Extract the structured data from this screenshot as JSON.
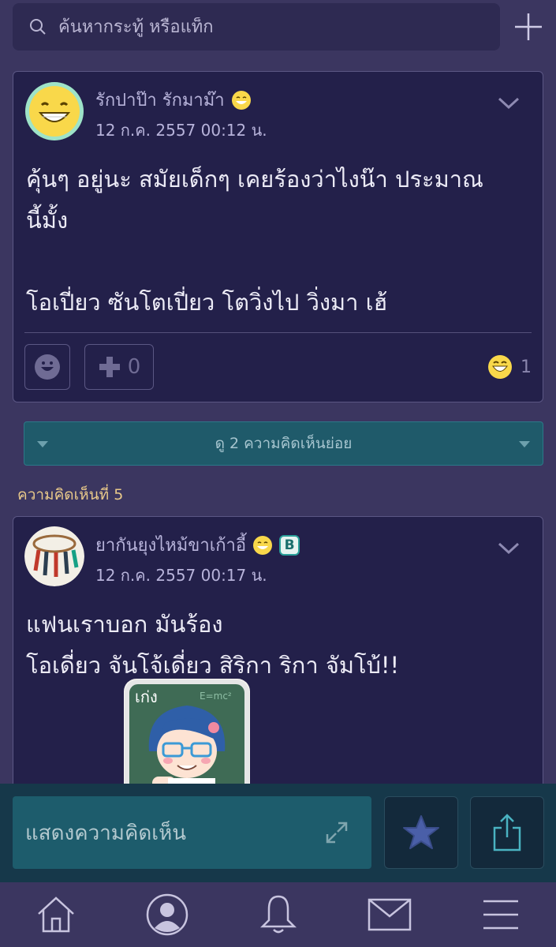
{
  "search": {
    "placeholder": "ค้นหากระทู้ หรือแท็ก"
  },
  "comment1": {
    "author": "รักปาป๊า รักมาม๊า",
    "date": "12 ก.ค. 2557 00:12 น.",
    "line1": "คุ้นๆ อยู่นะ สมัยเด็กๆ เคยร้องว่าไงน๊า ประมาณ",
    "line2": "นี้มั้ง",
    "line3": "โอเปี่ยว ซันโตเปี่ยว โตวิ่งไป วิ่งมา เฮ้",
    "vote_count": "0",
    "reaction_count": "1"
  },
  "subcomments_label": "ดู 2 ความคิดเห็นย่อย",
  "comment2": {
    "label": "ความคิดเห็นที่ 5",
    "author": "ยากันยุงไหม้ขาเก้าอี้",
    "badge": "B",
    "date": "12 ก.ค. 2557 00:17 น.",
    "line1": "แฟนเราบอก มันร้อง",
    "line2": "โอเดี่ยว จันโจ้เดี่ยว สิริกา ริกา จัมโบ้!!",
    "sticker_text": "เก่ง",
    "sticker_formula": "E=mc²"
  },
  "compose": {
    "placeholder": "แสดงความคิดเห็น"
  },
  "colors": {
    "background": "#3b3660",
    "card": "#23204a",
    "accent_teal": "#1d5c6c",
    "label_gold": "#e9c98a"
  },
  "icons": [
    "search-icon",
    "plus-icon",
    "chevron-down-icon",
    "smiley-icon",
    "plus-vote-icon",
    "expand-icon",
    "star-icon",
    "share-icon",
    "home-icon",
    "profile-icon",
    "bell-icon",
    "mail-icon",
    "menu-icon"
  ]
}
